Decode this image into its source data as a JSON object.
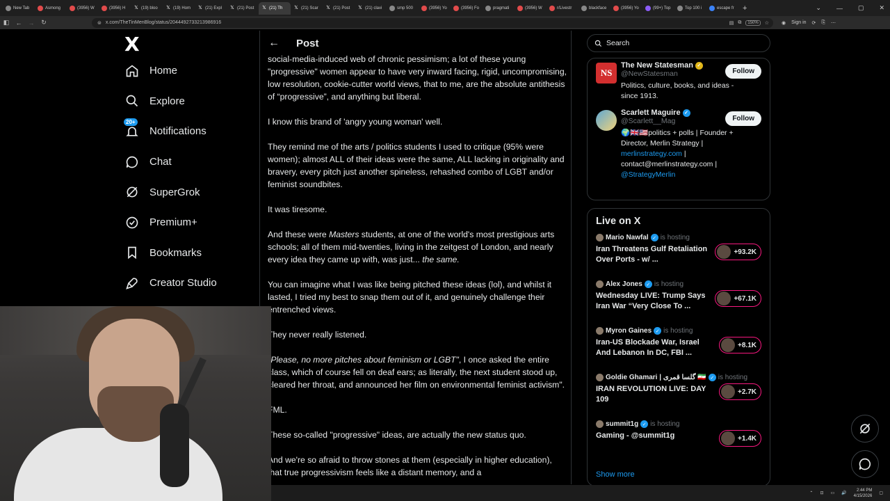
{
  "browser": {
    "tabs": [
      {
        "label": "New Tab",
        "fav": "gray"
      },
      {
        "label": "Asmong",
        "fav": "red"
      },
      {
        "label": "(3956) W",
        "fav": "red"
      },
      {
        "label": "(3956) H",
        "fav": "red"
      },
      {
        "label": "(19) bloo",
        "fav": "x"
      },
      {
        "label": "(19) Hom",
        "fav": "x"
      },
      {
        "label": "(21) Expl",
        "fav": "x"
      },
      {
        "label": "(21) Post",
        "fav": "x"
      },
      {
        "label": "(21) Th",
        "fav": "x",
        "active": true
      },
      {
        "label": "(21) Scar",
        "fav": "x"
      },
      {
        "label": "(21) Post",
        "fav": "x"
      },
      {
        "label": "(21) clavi",
        "fav": "x"
      },
      {
        "label": "smp 500",
        "fav": "gray"
      },
      {
        "label": "(3956) Yo",
        "fav": "red"
      },
      {
        "label": "(3956) Fo",
        "fav": "red"
      },
      {
        "label": "pragmati",
        "fav": "gray"
      },
      {
        "label": "(3956) W",
        "fav": "red"
      },
      {
        "label": "r/Livestr",
        "fav": "red"
      },
      {
        "label": "blackface",
        "fav": "gray"
      },
      {
        "label": "(3956) Yo",
        "fav": "red"
      },
      {
        "label": "(99+) Top",
        "fav": "purple"
      },
      {
        "label": "Top 100 i",
        "fav": "gray"
      },
      {
        "label": "escape fr",
        "fav": "blue"
      }
    ],
    "new_tab_symbol": "+",
    "url": "x.com/TheTinMenBlog/status/2044492733213986916",
    "zoom": "150%",
    "sign_in": "Sign in"
  },
  "nav": {
    "logo": "X",
    "items": [
      {
        "label": "Home",
        "icon": "home-icon"
      },
      {
        "label": "Explore",
        "icon": "search-icon"
      },
      {
        "label": "Notifications",
        "icon": "bell-icon",
        "badge": "20+"
      },
      {
        "label": "Chat",
        "icon": "chat-icon"
      },
      {
        "label": "SuperGrok",
        "icon": "grok-icon"
      },
      {
        "label": "Premium+",
        "icon": "premium-icon"
      },
      {
        "label": "Bookmarks",
        "icon": "bookmark-icon"
      },
      {
        "label": "Creator Studio",
        "icon": "rocket-icon"
      }
    ]
  },
  "main": {
    "header_title": "Post",
    "paragraphs": {
      "p1": "social-media-induced web of chronic pessimism; a lot of these young \"progressive\" women appear to have very inward facing, rigid, uncompromising, low resolution, cookie-cutter world views, that to me, are the absolute antithesis of “progressive”, and anything but liberal.",
      "p2": "I know this brand of 'angry young woman' well.",
      "p3": "They remind me of the arts / politics students I used to critique (95% were women); almost ALL of their ideas were the same, ALL lacking in originality and bravery, every pitch just another spineless, rehashed combo of LGBT and/or feminist soundbites.",
      "p4": "It was tiresome.",
      "p5a": "And these were ",
      "p5b": "Masters",
      "p5c": " students, at one of the world's most prestigious arts schools; all of them mid-twenties, living in the zeitgest of London, and nearly every idea they came up with, was just... ",
      "p5d": "the same.",
      "p6": "You can imagine what I was like being pitched these ideas (lol), and whilst it lasted, I tried my best to snap them out of it, and genuinely challenge their entrenched views.",
      "p7": "They never really listened.",
      "p8a": "\"Please, no more pitches about feminism or LGBT\"",
      "p8b": ", I once asked the entire class, which of course fell on deaf ears; as literally, the next student stood up, cleared her throat, and announced her film on environmental feminist activism\".",
      "p9": "FML.",
      "p10": "These so-called \"progressive\" ideas, are actually the new status quo.",
      "p11": "And we're so afraid to throw stones at them (especially in higher education), that true progressivism feels like a distant memory, and a"
    }
  },
  "right": {
    "search_placeholder": "Search",
    "accounts": [
      {
        "name": "The New Statesman",
        "handle": "@NewStatesman",
        "bio": "Politics, culture, books, and ideas - since 1913.",
        "verified": "gold",
        "follow": "Follow",
        "avatar_text": "NS"
      },
      {
        "name": "Scarlett Maguire",
        "handle": "@Scarlett__Mag",
        "bio_lines": [
          "🌍🇬🇧🇺🇸politics + polls | Founder + Director, Merlin Strategy |",
          "merlinstrategy.com",
          " | contact@merlinstrategy.com |",
          "@StrategyMerlin"
        ],
        "verified": "blue",
        "follow": "Follow"
      }
    ],
    "live": {
      "title": "Live on X",
      "hosting_label": "is hosting",
      "items": [
        {
          "host": "Mario Nawfal",
          "headline": "Iran Threatens Gulf Retaliation Over Ports - w/ ...",
          "count": "+93.2K"
        },
        {
          "host": "Alex Jones",
          "headline": "Wednesday LIVE: Trump Says Iran War “Very Close To ...",
          "count": "+67.1K"
        },
        {
          "host": "Myron Gaines",
          "headline": "Iran-US Blockade War, Israel And Lebanon In DC, FBI ...",
          "count": "+8.1K"
        },
        {
          "host": "Goldie Ghamari | گلسا قمری 🇮🇷",
          "headline": "IRAN REVOLUTION LIVE: DAY 109",
          "count": "+2.7K"
        },
        {
          "host": "summit1g",
          "headline": "Gaming - @summit1g",
          "count": "+1.4K"
        }
      ],
      "show_more": "Show more"
    }
  },
  "taskbar": {
    "time": "2:44 PM",
    "date": "4/15/2026"
  },
  "colors": {
    "accent": "#1d9bf0",
    "live_ring": "#f91880",
    "border": "#2f3336"
  }
}
